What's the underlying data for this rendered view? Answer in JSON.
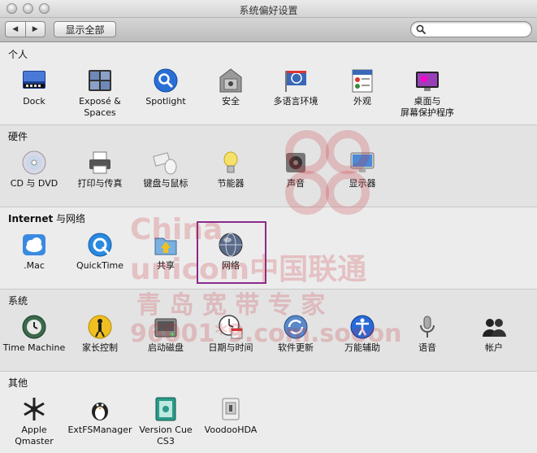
{
  "window": {
    "title": "系统偏好设置"
  },
  "toolbar": {
    "back": "◀",
    "forward": "▶",
    "show_all": "显示全部",
    "search_placeholder": ""
  },
  "sections": [
    {
      "title_bold": "",
      "title": "个人",
      "panes": [
        {
          "label": "Dock",
          "icon": "dock-icon"
        },
        {
          "label": "Exposé &\nSpaces",
          "icon": "expose-icon"
        },
        {
          "label": "Spotlight",
          "icon": "spotlight-icon"
        },
        {
          "label": "安全",
          "icon": "security-icon"
        },
        {
          "label": "多语言环境",
          "icon": "international-icon"
        },
        {
          "label": "外观",
          "icon": "appearance-icon"
        },
        {
          "label": "桌面与\n屏幕保护程序",
          "icon": "desktop-screensaver-icon"
        }
      ]
    },
    {
      "title_bold": "",
      "title": "硬件",
      "panes": [
        {
          "label": "CD 与 DVD",
          "icon": "cd-dvd-icon"
        },
        {
          "label": "打印与传真",
          "icon": "printer-icon"
        },
        {
          "label": "键盘与鼠标",
          "icon": "keyboard-mouse-icon"
        },
        {
          "label": "节能器",
          "icon": "energy-saver-icon"
        },
        {
          "label": "声音",
          "icon": "sound-icon"
        },
        {
          "label": "显示器",
          "icon": "displays-icon"
        }
      ]
    },
    {
      "title_bold": "Internet",
      "title": " 与网络",
      "panes": [
        {
          "label": ".Mac",
          "icon": "mac-cloud-icon"
        },
        {
          "label": "QuickTime",
          "icon": "quicktime-icon"
        },
        {
          "label": "共享",
          "icon": "sharing-icon"
        },
        {
          "label": "网络",
          "icon": "network-icon"
        }
      ]
    },
    {
      "title_bold": "",
      "title": "系统",
      "panes": [
        {
          "label": "Time Machine",
          "icon": "time-machine-icon"
        },
        {
          "label": "家长控制",
          "icon": "parental-controls-icon"
        },
        {
          "label": "启动磁盘",
          "icon": "startup-disk-icon"
        },
        {
          "label": "日期与时间",
          "icon": "date-time-icon"
        },
        {
          "label": "软件更新",
          "icon": "software-update-icon"
        },
        {
          "label": "万能辅助",
          "icon": "universal-access-icon"
        },
        {
          "label": "语音",
          "icon": "speech-icon"
        },
        {
          "label": "帐户",
          "icon": "accounts-icon"
        }
      ]
    },
    {
      "title_bold": "",
      "title": "其他",
      "panes": [
        {
          "label": "Apple\nQmaster",
          "icon": "qmaster-icon"
        },
        {
          "label": "ExtFSManager",
          "icon": "extfsmanager-icon"
        },
        {
          "label": "Version Cue\nCS3",
          "icon": "version-cue-icon"
        },
        {
          "label": "VoodooHDA",
          "icon": "voodoohda-icon"
        }
      ]
    }
  ],
  "watermark": {
    "line1": "China",
    "line2": "unicom中国联通",
    "line3": "青 岛 宽 带 专 家",
    "line4": "96001*9.com.sooon"
  },
  "colors": {
    "highlight": "#8a2a8a",
    "watermark": "#c82832"
  }
}
